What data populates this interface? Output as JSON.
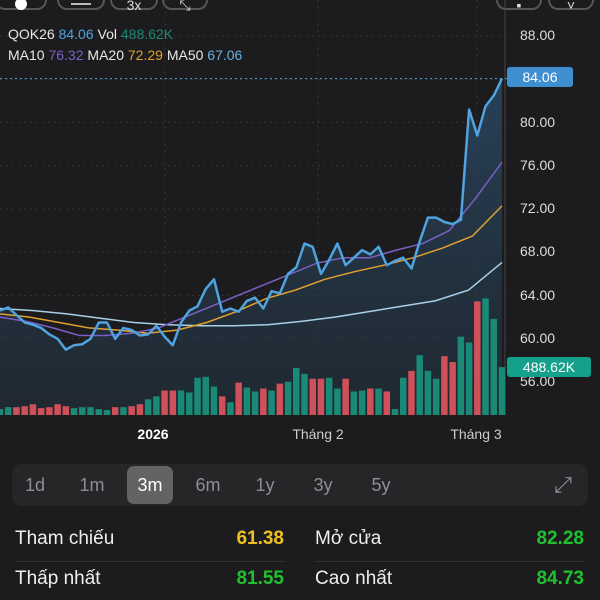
{
  "toolbar": {
    "buttons": [
      {
        "icon": "circle-icon"
      },
      {
        "icon": "minus-icon"
      },
      {
        "label": "3x"
      },
      {
        "icon": "expand-icon"
      },
      {
        "icon": "cart-icon"
      },
      {
        "icon": "chevron-icon"
      }
    ]
  },
  "legend": {
    "symbol": "QOK26",
    "price": "84.06",
    "vol_label": "Vol",
    "vol": "488.62K",
    "ma10_label": "MA10",
    "ma10": "76.32",
    "ma20_label": "MA20",
    "ma20": "72.29",
    "ma50_label": "MA50",
    "ma50": "67.06"
  },
  "colors": {
    "price": "#4fa3e0",
    "ma10": "#7b5fc4",
    "ma20": "#e0a030",
    "ma50": "#a8d0e8",
    "up": "#1a8a76",
    "down": "#d0505a",
    "price_tag": "#3f8fd0",
    "vol_tag": "#14a08a",
    "ref": "#f0c020",
    "green": "#20c030"
  },
  "chart_data": {
    "type": "line",
    "y_ticks": [
      "88.00",
      "84.00",
      "80.00",
      "76.00",
      "72.00",
      "68.00",
      "64.00",
      "60.00",
      "56.00"
    ],
    "ylim": [
      56,
      88
    ],
    "x_ticks": [
      "2026",
      "Tháng 2",
      "Tháng 3"
    ],
    "last_price": "84.06",
    "last_volume": "488.62K",
    "close": [
      62.6,
      62.9,
      62.2,
      61.5,
      61.3,
      61.0,
      60.4,
      60.0,
      59.0,
      59.4,
      59.5,
      60.0,
      61.5,
      61.5,
      60.0,
      61.0,
      60.8,
      60.3,
      60.4,
      61.2,
      60.2,
      59.4,
      61.5,
      62.6,
      63.0,
      64.6,
      65.5,
      62.5,
      62.8,
      62.5,
      63.5,
      63.8,
      62.8,
      64.4,
      64.2,
      66.0,
      66.6,
      68.8,
      68.5,
      66.0,
      67.3,
      68.8,
      66.8,
      67.5,
      68.2,
      67.8,
      68.5,
      66.8,
      67.2,
      67.5,
      66.5,
      69.0,
      71.2,
      71.2,
      70.8,
      70.6,
      71.0,
      81.2,
      78.8,
      81.5,
      82.5,
      84.06
    ],
    "ma10": [
      62.0,
      61.6,
      61.0,
      60.3,
      60.3,
      60.5,
      61.0,
      62.0,
      63.0,
      64.0,
      65.0,
      66.0,
      67.0,
      67.5,
      67.5,
      68.2,
      68.8,
      70.0,
      73.0,
      76.32
    ],
    "ma20": [
      62.3,
      62.0,
      61.5,
      61.0,
      60.8,
      60.5,
      60.8,
      61.5,
      62.5,
      63.7,
      64.5,
      65.5,
      66.2,
      66.8,
      67.5,
      68.4,
      69.5,
      72.29
    ],
    "ma50": [
      62.8,
      62.6,
      62.3,
      61.9,
      61.5,
      61.3,
      61.2,
      61.2,
      61.3,
      61.6,
      62.0,
      62.5,
      63.0,
      63.5,
      64.5,
      67.06
    ],
    "volume_k": [
      60,
      80,
      80,
      90,
      110,
      70,
      80,
      110,
      90,
      70,
      80,
      80,
      60,
      50,
      80,
      80,
      90,
      110,
      160,
      190,
      250,
      250,
      250,
      230,
      380,
      390,
      290,
      190,
      130,
      330,
      280,
      240,
      270,
      250,
      320,
      340,
      480,
      420,
      370,
      370,
      380,
      270,
      370,
      240,
      250,
      270,
      270,
      240,
      60,
      380,
      450,
      610,
      450,
      370,
      600,
      540,
      800,
      740,
      1160,
      1190,
      980,
      488.62
    ]
  },
  "periods": {
    "items": [
      "1d",
      "1m",
      "3m",
      "6m",
      "1y",
      "3y",
      "5y"
    ],
    "selected": "3m",
    "expand_icon": "expand-arrows-icon"
  },
  "stats": {
    "ref_label": "Tham chiếu",
    "ref": "61.38",
    "open_label": "Mở cửa",
    "open": "82.28",
    "low_label": "Thấp nhất",
    "low": "81.55",
    "high_label": "Cao nhất",
    "high": "84.73"
  }
}
